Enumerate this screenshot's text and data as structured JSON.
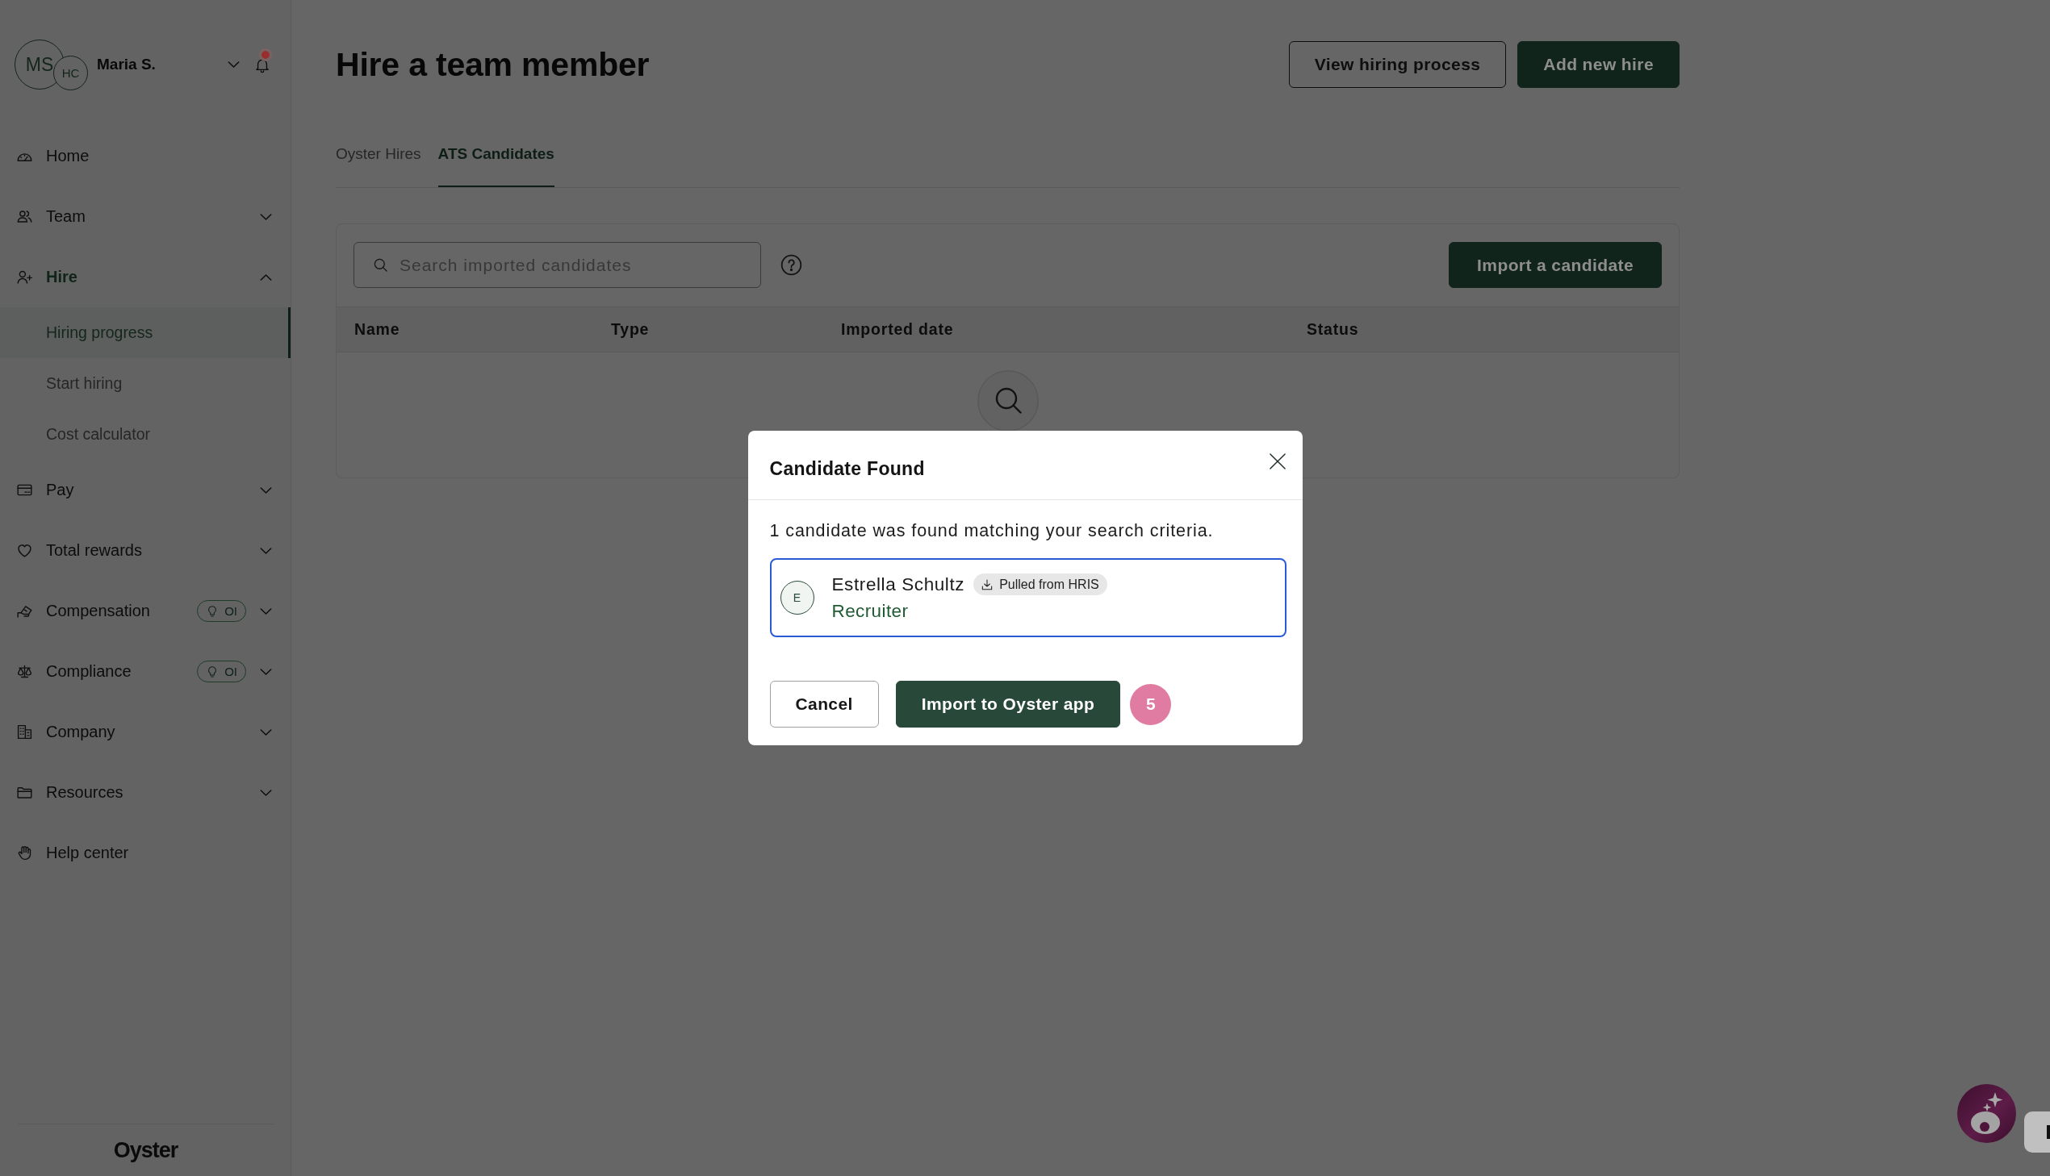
{
  "sidebar": {
    "user": {
      "initials": "MS",
      "company_initials": "HC",
      "name": "Maria S.",
      "notification": true
    },
    "items": [
      {
        "label": "Home",
        "selected": false
      },
      {
        "label": "Team",
        "selected": false,
        "expanded": false
      },
      {
        "label": "Hire",
        "selected": true,
        "expanded": true,
        "children": [
          {
            "label": "Hiring progress",
            "selected": true
          },
          {
            "label": "Start hiring",
            "selected": false
          },
          {
            "label": "Cost calculator",
            "selected": false
          }
        ]
      },
      {
        "label": "Pay",
        "selected": false,
        "expanded": false
      },
      {
        "label": "Total rewards",
        "selected": false,
        "expanded": false
      },
      {
        "label": "Compensation",
        "selected": false,
        "expanded": false,
        "badge": "OI"
      },
      {
        "label": "Compliance",
        "selected": false,
        "expanded": false,
        "badge": "OI"
      },
      {
        "label": "Company",
        "selected": false,
        "expanded": false
      },
      {
        "label": "Resources",
        "selected": false,
        "expanded": false
      },
      {
        "label": "Help center",
        "selected": false
      }
    ],
    "logo": "Oyster"
  },
  "header": {
    "title": "Hire a team member",
    "buttons": [
      {
        "label": "View hiring process",
        "kind": "secondary"
      },
      {
        "label": "Add new hire",
        "kind": "primary"
      }
    ]
  },
  "tabs": [
    {
      "label": "Oyster Hires",
      "selected": false
    },
    {
      "label": "ATS Candidates",
      "selected": true
    }
  ],
  "candidates_panel": {
    "search": {
      "placeholder": "Search imported candidates"
    },
    "import_button": "Import a candidate",
    "table": {
      "columns": [
        "Name",
        "Type",
        "Imported date",
        "Status"
      ]
    }
  },
  "modal": {
    "title": "Candidate Found",
    "message": "1 candidate was found matching your search criteria.",
    "candidates": [
      {
        "initial": "E",
        "name": "Estrella Schultz",
        "tag": "Pulled from HRIS",
        "role": "Recruiter",
        "selected": true
      }
    ],
    "buttons": [
      {
        "label": "Cancel",
        "kind": "secondary"
      },
      {
        "label": "Import to Oyster app",
        "kind": "primary"
      }
    ],
    "step_badge": "5"
  }
}
